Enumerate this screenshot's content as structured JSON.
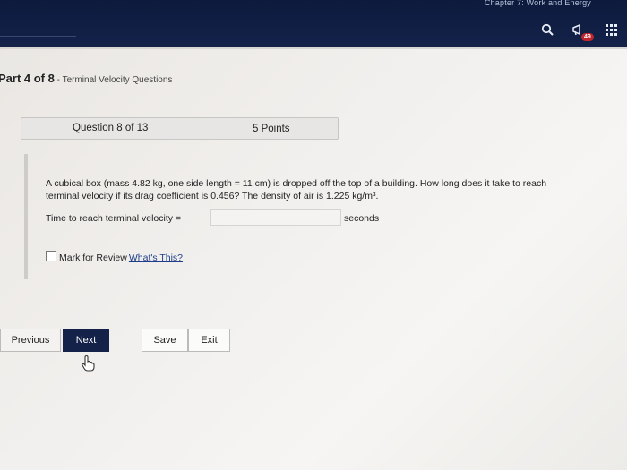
{
  "header": {
    "breadcrumb": "Chapter 7: Work and Energy",
    "badge_count": "49",
    "icons": {
      "search": "search-icon",
      "notify": "megaphone-icon",
      "apps": "grid-icon"
    }
  },
  "part": {
    "label": "Part 4 of 8",
    "separator": " - ",
    "subtitle": "Terminal Velocity Questions"
  },
  "question": {
    "number_label": "Question 8 of 13",
    "points_label": "5 Points",
    "text_line1": "A cubical box (mass 4.82 kg, one side length = 11 cm) is dropped off the top of a building. How long does it take to reach",
    "text_line2": "terminal velocity if its drag coefficient is 0.456? The density of air is 1.225 kg/m³.",
    "answer_label": "Time to reach terminal velocity =",
    "answer_value": "",
    "answer_unit": "seconds",
    "review_label": "Mark for Review",
    "whats_this": "What's This?"
  },
  "buttons": {
    "previous": "Previous",
    "next": "Next",
    "save": "Save",
    "exit": "Exit"
  },
  "colors": {
    "header_bg": "#14224a",
    "next_bg": "#14224a",
    "badge": "#c0262d",
    "link": "#1e3e8a"
  }
}
